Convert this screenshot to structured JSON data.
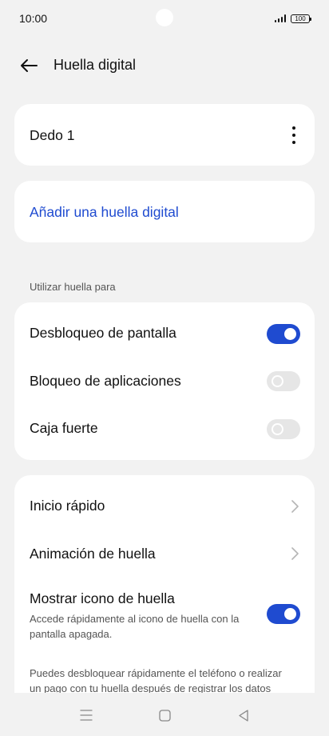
{
  "status_bar": {
    "time": "10:00",
    "battery": "100"
  },
  "header": {
    "title": "Huella digital",
    "back_icon": "arrow-left-icon"
  },
  "fingerprint_card": {
    "name": "Dedo 1",
    "menu_icon": "more-vertical-icon"
  },
  "add_card": {
    "label": "Añadir una huella digital"
  },
  "use_section": {
    "caption": "Utilizar huella para",
    "items": [
      {
        "label": "Desbloqueo de pantalla",
        "enabled": true
      },
      {
        "label": "Bloqueo de aplicaciones",
        "enabled": false
      },
      {
        "label": "Caja fuerte",
        "enabled": false
      }
    ]
  },
  "more_section": {
    "items": [
      {
        "label": "Inicio rápido",
        "icon": "chevron-right-icon"
      },
      {
        "label": "Animación de huella",
        "icon": "chevron-right-icon"
      }
    ],
    "show_icon": {
      "label": "Mostrar icono de huella",
      "description_line1": "Accede rápidamente al icono de huella con la",
      "description_line2": "pantalla apagada.",
      "enabled": true
    },
    "footnote_line1": "Puedes desbloquear rápidamente el teléfono o realizar",
    "footnote_line2": "un pago con tu huella después de registrar los datos"
  },
  "nav_bar": {
    "menu_icon": "menu-icon",
    "home_icon": "home-square-icon",
    "back_icon": "back-triangle-icon"
  },
  "colors": {
    "accent": "#1f4bd0",
    "background": "#f2f2f2",
    "card": "#ffffff",
    "toggle_off": "#e6e6e6"
  }
}
